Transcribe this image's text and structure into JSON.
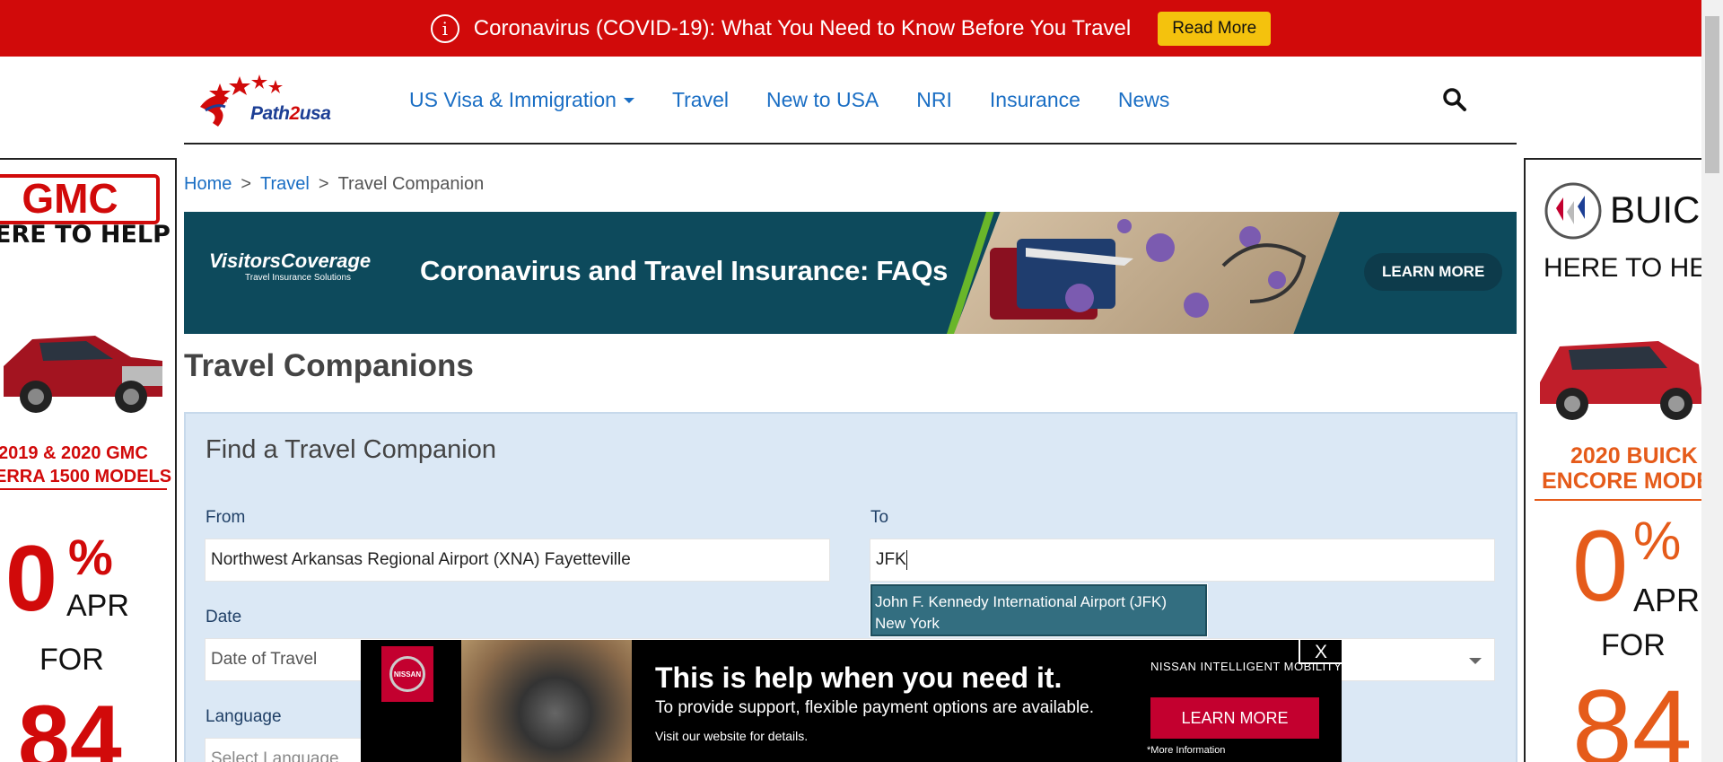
{
  "alert": {
    "icon": "info-circle-icon",
    "icon_glyph": "i",
    "text": "Coronavirus (COVID-19): What You Need to Know Before You Travel",
    "button": "Read More",
    "bg": "#d10a0a",
    "button_bg": "#f4c20d"
  },
  "logo": {
    "text_a": "Path",
    "text_b": "2",
    "text_c": "usa"
  },
  "nav": {
    "items": [
      "US Visa & Immigration",
      "Travel",
      "New to USA",
      "NRI",
      "Insurance",
      "News"
    ],
    "search_icon": "search-icon"
  },
  "breadcrumb": {
    "items": [
      "Home",
      ">",
      "Travel",
      ">",
      "Travel Companion"
    ]
  },
  "banner": {
    "brand": "VisitorsCoverage",
    "brand_tag": "Travel Insurance Solutions",
    "title": "Coronavirus and Travel Insurance: FAQs",
    "button": "LEARN MORE"
  },
  "page": {
    "title": "Travel Companions",
    "form_title": "Find a Travel Companion"
  },
  "form": {
    "from_label": "From",
    "from_value": "Northwest Arkansas Regional Airport (XNA) Fayetteville",
    "to_label": "To",
    "to_value": "JFK",
    "date_label": "Date",
    "date_placeholder": "Date of Travel",
    "language_label": "Language",
    "language_placeholder": "Select Language"
  },
  "autocomplete": {
    "line1": "John F. Kennedy International Airport (JFK)",
    "line2": "New York"
  },
  "ad_left": {
    "brand": "GMC",
    "headline": "ERE TO HELP",
    "sub1": "2019 & 2020 GMC",
    "sub2": "ERRA 1500 MODELS",
    "big": "0",
    "pct": "%",
    "apr": "APR",
    "for": "FOR",
    "num": "84"
  },
  "ad_right": {
    "brand": "BUIC",
    "headline": "HERE TO HE",
    "sub1": "2020 BUICK",
    "sub2": "ENCORE MODE",
    "big": "0",
    "pct": "%",
    "apr": "APR",
    "for": "FOR",
    "num": "84"
  },
  "bottom_ad": {
    "close": "X",
    "badge": "NISSAN",
    "headline": "This is help when you need it.",
    "sub": "To provide support, flexible payment options are available.",
    "small": "Visit our website for details.",
    "tag": "NISSAN INTELLIGENT MOBILITY",
    "button": "LEARN MORE",
    "note": "*More Information"
  },
  "colors": {
    "link": "#1a6ec4",
    "panel_bg": "#dbe8f5",
    "autocomplete_bg": "#336e80",
    "nissan_red": "#c3002f"
  }
}
